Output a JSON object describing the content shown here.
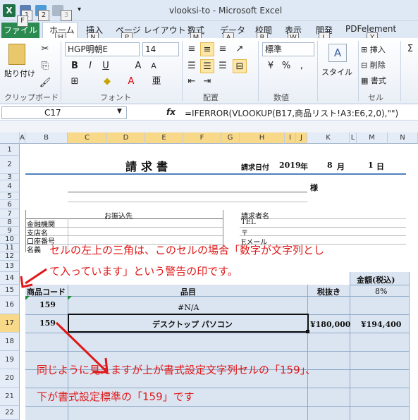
{
  "window": {
    "title": "vlooksi-to  -  Microsoft Excel",
    "keytips": [
      "1",
      "2",
      "3"
    ]
  },
  "tabs": {
    "file": "ファイル",
    "items": [
      "ホーム",
      "挿入",
      "ページ レイアウト",
      "数式",
      "データ",
      "校閲",
      "表示",
      "開発",
      "PDFelement"
    ],
    "keytips": [
      "F",
      "H",
      "N",
      "P",
      "M",
      "A",
      "R",
      "W",
      "L",
      "Y"
    ]
  },
  "ribbon": {
    "clipboard": {
      "paste": "貼り付け",
      "label": "クリップボード"
    },
    "font": {
      "name": "HGP明朝E",
      "size": "14",
      "label": "フォント"
    },
    "alignment": {
      "label": "配置"
    },
    "number": {
      "format": "標準",
      "label": "数値"
    },
    "styles": {
      "style": "スタイル"
    },
    "cells": {
      "insert": "挿入",
      "delete": "削除",
      "format": "書式",
      "label": "セル"
    }
  },
  "formula_bar": {
    "name_box": "C17",
    "fx": "fx",
    "formula": "=IFERROR(VLOOKUP(B17,商品リスト!A3:E6,2,0),\"\")"
  },
  "grid": {
    "columns": [
      "A",
      "B",
      "C",
      "D",
      "E",
      "F",
      "G",
      "H",
      "I",
      "J",
      "K",
      "L",
      "M",
      "N"
    ],
    "rows": [
      "1",
      "2",
      "3",
      "4",
      "5",
      "6",
      "7",
      "8",
      "9",
      "10",
      "11",
      "12",
      "13",
      "14",
      "15",
      "16",
      "17",
      "18",
      "19",
      "20",
      "21",
      "22"
    ],
    "invoice_title": "請求書",
    "date_label": "請求日付",
    "year": "2019",
    "year_unit": "年",
    "month": "8",
    "month_unit": "月",
    "day": "1",
    "day_unit": "日",
    "sama": "様",
    "furikomi": "お振込先",
    "bank": "金融機関",
    "branch": "支店名",
    "account": "口座番号",
    "meigi": "名義",
    "requester": "請求者名",
    "tel": "TEL",
    "postal": "〒",
    "email": "Eメール",
    "amount_header": "金額(税込)",
    "tax_rate": "8%",
    "code_header": "商品コード",
    "item_header": "品目",
    "pretax_header": "税抜き",
    "row16_code": "159",
    "row16_item": "#N/A",
    "row17_code": "159",
    "row17_item": "デスクトップ パソコン",
    "row17_pretax": "¥180,000",
    "row17_total": "¥194,400"
  },
  "annotations": {
    "top_line1": "セルの左上の三角は、このセルの場合「数字が文字列とし",
    "top_line2": "て入っています」という警告の印です。",
    "bottom_line1": "同じように見えますが上が書式設定文字列セルの「159」、",
    "bottom_line2": "下が書式設定標準の「159」です"
  },
  "colors": {
    "annotation": "#e01818",
    "header_fill": "#dbe5f1",
    "accent_blue": "#4f81bd"
  }
}
